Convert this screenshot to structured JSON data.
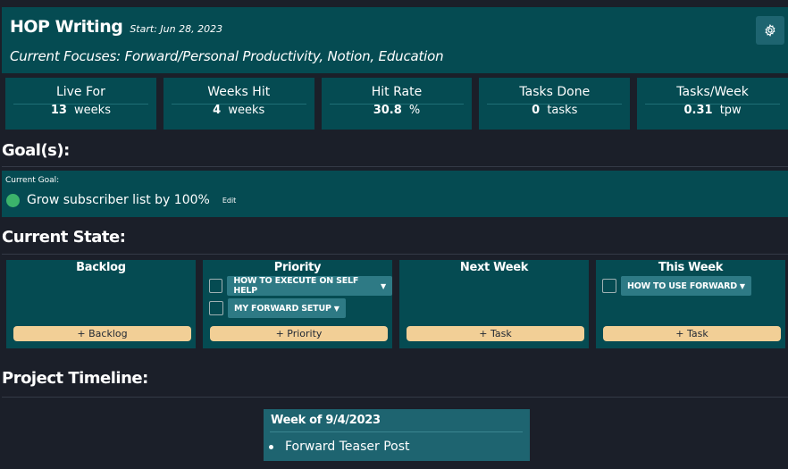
{
  "header": {
    "title": "HOP Writing",
    "start": "Start: Jun 28, 2023",
    "focuses": "Current Focuses: Forward/Personal Productivity, Notion, Education",
    "settings_icon": "gear-icon"
  },
  "stats": [
    {
      "label": "Live For",
      "value": "13",
      "unit": "weeks"
    },
    {
      "label": "Weeks Hit",
      "value": "4",
      "unit": "weeks"
    },
    {
      "label": "Hit Rate",
      "value": "30.8",
      "unit": "%"
    },
    {
      "label": "Tasks Done",
      "value": "0",
      "unit": "tasks"
    },
    {
      "label": "Tasks/Week",
      "value": "0.31",
      "unit": "tpw"
    }
  ],
  "goals": {
    "heading": "Goal(s):",
    "current_label": "Current Goal:",
    "goal_text": "Grow subscriber list by 100%",
    "edit_label": "Edit",
    "status_color": "#3cb36b"
  },
  "current_state": {
    "heading": "Current State:",
    "columns": [
      {
        "title": "Backlog",
        "tasks": [],
        "add_label": "+ Backlog"
      },
      {
        "title": "Priority",
        "tasks": [
          "HOW TO EXECUTE ON SELF HELP",
          "MY FORWARD SETUP"
        ],
        "add_label": "+ Priority"
      },
      {
        "title": "Next Week",
        "tasks": [],
        "add_label": "+ Task"
      },
      {
        "title": "This Week",
        "tasks": [
          "HOW TO USE FORWARD"
        ],
        "add_label": "+ Task"
      }
    ]
  },
  "timeline": {
    "heading": "Project Timeline:",
    "week_title": "Week of 9/4/2023",
    "items": [
      "Forward Teaser Post"
    ]
  },
  "colors": {
    "background": "#1b1f29",
    "panel": "#054b52",
    "accent_button": "#f2cf96",
    "chip": "#2e7a85"
  }
}
